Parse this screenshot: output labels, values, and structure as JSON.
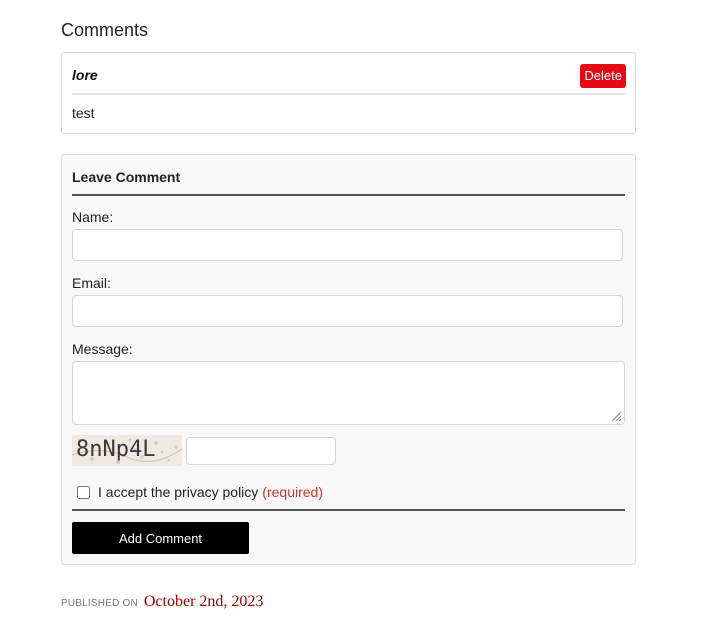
{
  "comments_section": {
    "title": "Comments",
    "items": [
      {
        "author": "lore",
        "text": "test",
        "delete_label": "Delete"
      }
    ]
  },
  "comment_form": {
    "title": "Leave Comment",
    "name_label": "Name:",
    "email_label": "Email:",
    "message_label": "Message:",
    "name_value": "",
    "email_value": "",
    "message_value": "",
    "captcha_text": "8nNp4L",
    "captcha_value": "",
    "privacy_label": "I accept the privacy policy",
    "privacy_required": "(required)",
    "privacy_checked": false,
    "submit_label": "Add Comment"
  },
  "post_meta": {
    "published_label": "PUBLISHED ON",
    "published_date": "October 2nd, 2023"
  },
  "colors": {
    "delete_button": "#e50914",
    "required_text": "#c0392b",
    "date_text": "#a30000",
    "submit_button": "#000000"
  }
}
